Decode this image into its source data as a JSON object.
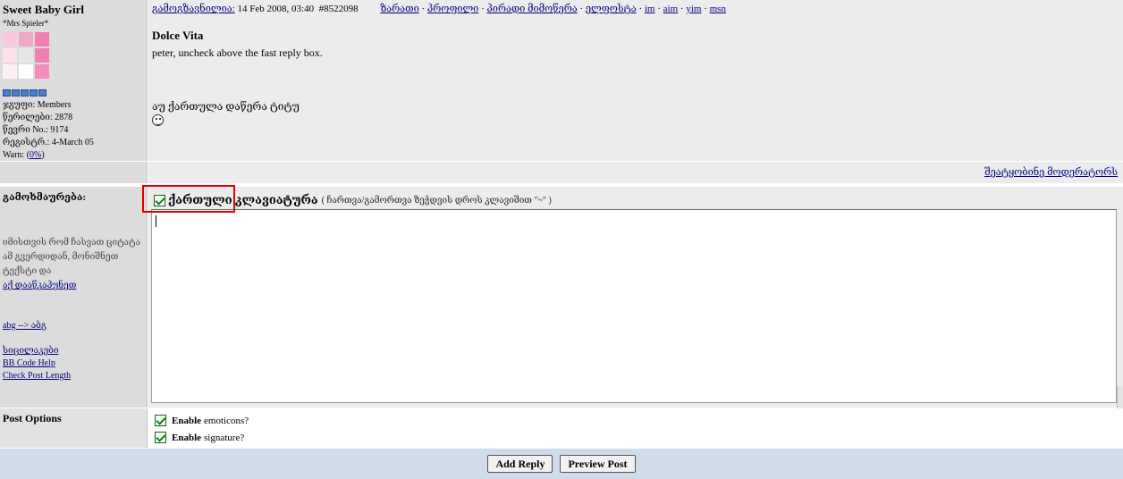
{
  "user": {
    "name": "Sweet Baby Girl",
    "title": "*Mrs Spieler*",
    "group_label": "ჯგუფი:",
    "group_value": "Members",
    "posts_label": "წერილები:",
    "posts_value": "2878",
    "member_no_label": "წევრი No.:",
    "member_no_value": "9174",
    "joined_label": "რეგისტრ.:",
    "joined_value": "4-March 05",
    "warn_label": "Warn:",
    "warn_open": "(",
    "warn_value": "0%",
    "warn_close": ")",
    "avatar_colors": [
      "#f9c8dc",
      "#f4a6c8",
      "#f07fb4",
      "#fde0ec",
      "#e6e6e6",
      "#f07fb4",
      "#fdf0f5",
      "#ffffff",
      "#f48cbc"
    ]
  },
  "post": {
    "sent_label": "გამოგზავნილია:",
    "datetime": "14 Feb 2008, 03:40",
    "post_number": "#8522098",
    "actions": [
      "ზარათი",
      "პროფილი",
      "პირადი მიმოწერა",
      "ელფოსტა",
      "im",
      "aim",
      "yim",
      "msn"
    ],
    "separator": "·",
    "title": "Dolce Vita",
    "body": "peter, uncheck above the fast reply box.",
    "georgian_line": "აუ ქართულა დაწერა ტიტუ",
    "smiley_icon": "smiley-icon"
  },
  "report_link": "შეატყობინე მოდერატორს",
  "reply": {
    "label": "გამოხმაურება:",
    "help_text": "იმისთვის რომ ჩასვათ ციტატა ამ გვერდიდან, მონიშნეთ ტექსტი და",
    "help_link": "აქ დააწკაპუნეთ",
    "abg_link": "abg --> აბგ",
    "links": [
      "სიცილაკები",
      "BB Code Help",
      "Check Post Length"
    ],
    "keyboard_label": "ქართული კლავიატურა",
    "keyboard_note": "( ჩართვა/გამორთვა ზეჭდვის დროს კლავიშით \"~\" )",
    "keyboard_checked": true,
    "textarea_value": ""
  },
  "options": {
    "label": "Post Options",
    "items": [
      {
        "bold": "Enable",
        "rest": "emoticons?",
        "checked": true
      },
      {
        "bold": "Enable",
        "rest": "signature?",
        "checked": true
      }
    ]
  },
  "buttons": {
    "add_reply": "Add Reply",
    "preview": "Preview Post"
  },
  "colors": {
    "highlight": "#e00000",
    "link": "#000080",
    "bottom_bar": "#d0dcea"
  }
}
